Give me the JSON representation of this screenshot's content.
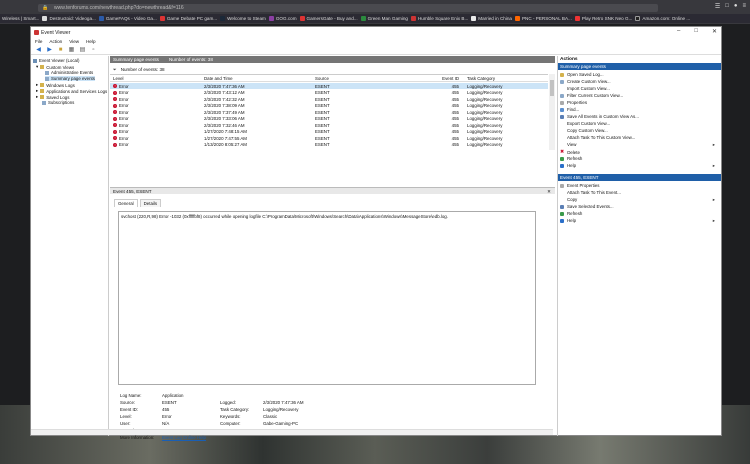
{
  "browser": {
    "url": "www.tenforums.com/newthread.php?do=newthread&f=116",
    "bookmarks": [
      "Wireless | Smart...",
      "Destructoid: Videoga...",
      "GameFAQs - Video Ga...",
      "Game Debate PC gam...",
      "Welcome to Steam",
      "GOG.com",
      "GamersGate - Buy and...",
      "Green Man Gaming",
      "Humble Square Enix B...",
      "Married in China",
      "PNC - PERSONAL BA...",
      "Play Retro SNK Neo G...",
      "Amazon.com: Online ..."
    ]
  },
  "window": {
    "title": "Event Viewer",
    "menu": [
      "File",
      "Action",
      "View",
      "Help"
    ]
  },
  "tree": {
    "items": [
      {
        "label": "Event Viewer (Local)"
      },
      {
        "label": "Custom Views"
      },
      {
        "label": "Administrative Events"
      },
      {
        "label": "Summary page events"
      },
      {
        "label": "Windows Logs"
      },
      {
        "label": "Applications and Services Logs"
      },
      {
        "label": "Saved Logs"
      },
      {
        "label": "Subscriptions"
      }
    ]
  },
  "summary": {
    "header_title": "Summary page events",
    "header_count": "Number of events: 38",
    "filter_text": "Number of events: 38",
    "columns": [
      "Level",
      "Date and Time",
      "Source",
      "Event ID",
      "Task Category"
    ],
    "rows": [
      {
        "level": "Error",
        "datetime": "2/3/2020 7:47:36 AM",
        "source": "ESENT",
        "id": "455",
        "category": "Logging/Recovery"
      },
      {
        "level": "Error",
        "datetime": "2/3/2020 7:43:12 AM",
        "source": "ESENT",
        "id": "455",
        "category": "Logging/Recovery"
      },
      {
        "level": "Error",
        "datetime": "2/3/2020 7:42:32 AM",
        "source": "ESENT",
        "id": "455",
        "category": "Logging/Recovery"
      },
      {
        "level": "Error",
        "datetime": "2/3/2020 7:38:09 AM",
        "source": "ESENT",
        "id": "455",
        "category": "Logging/Recovery"
      },
      {
        "level": "Error",
        "datetime": "2/3/2020 7:37:49 AM",
        "source": "ESENT",
        "id": "455",
        "category": "Logging/Recovery"
      },
      {
        "level": "Error",
        "datetime": "2/3/2020 7:33:06 AM",
        "source": "ESENT",
        "id": "455",
        "category": "Logging/Recovery"
      },
      {
        "level": "Error",
        "datetime": "2/3/2020 7:32:46 AM",
        "source": "ESENT",
        "id": "455",
        "category": "Logging/Recovery"
      },
      {
        "level": "Error",
        "datetime": "1/27/2020 7:48:15 AM",
        "source": "ESENT",
        "id": "455",
        "category": "Logging/Recovery"
      },
      {
        "level": "Error",
        "datetime": "1/27/2020 7:47:55 AM",
        "source": "ESENT",
        "id": "455",
        "category": "Logging/Recovery"
      },
      {
        "level": "Error",
        "datetime": "1/13/2020 8:05:27 AM",
        "source": "ESENT",
        "id": "455",
        "category": "Logging/Recovery"
      }
    ]
  },
  "detail": {
    "title": "Event 455, ESENT",
    "tabs": [
      "General",
      "Details"
    ],
    "message": "svchost (220,R,98) Error -1032 (0xfffffbf8) occurred while opening logfile C:\\ProgramData\\Microsoft\\Windows\\Search\\Data\\Applications\\Windows\\MessageStore\\edb.log.",
    "props": {
      "log_name_label": "Log Name:",
      "log_name": "Application",
      "source_label": "Source:",
      "source": "ESENT",
      "logged_label": "Logged:",
      "logged": "2/3/2020 7:47:36 AM",
      "event_id_label": "Event ID:",
      "event_id": "455",
      "task_label": "Task Category:",
      "task": "Logging/Recovery",
      "level_label": "Level:",
      "level": "Error",
      "keywords_label": "Keywords:",
      "keywords": "Classic",
      "user_label": "User:",
      "user": "N/A",
      "computer_label": "Computer:",
      "computer": "Gabe-Gaming-PC",
      "opcode_label": "OpCode:",
      "opcode": "",
      "more_label": "More Information:",
      "more_link": "Event Log Online Help"
    }
  },
  "actions": {
    "title": "Actions",
    "section1": "Summary page events",
    "items1": [
      "Open Saved Log...",
      "Create Custom View...",
      "Import Custom View...",
      "Filter Current Custom View...",
      "Properties",
      "Find...",
      "Save All Events in Custom View As...",
      "Export Custom View...",
      "Copy Custom View...",
      "Attach Task To This Custom View...",
      "View",
      "Delete",
      "Refresh",
      "Help"
    ],
    "section2": "Event 455, ESENT",
    "items2": [
      "Event Properties",
      "Attach Task To This Event...",
      "Copy",
      "Save Selected Events...",
      "Refresh",
      "Help"
    ]
  }
}
